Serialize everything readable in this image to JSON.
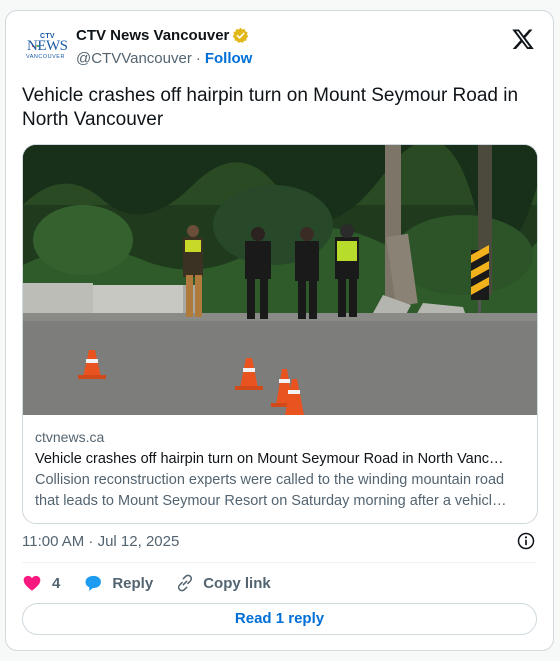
{
  "account": {
    "display_name": "CTV News Vancouver",
    "handle": "@CTVVancouver",
    "separator": "·",
    "follow_label": "Follow",
    "logo": {
      "brand_mark": "CTV",
      "wordmark": "NEWS",
      "city": "VANCOUVER",
      "brand_color": "#1a5aa6"
    },
    "verified_color": "#e2b719"
  },
  "tweet": {
    "text": "Vehicle crashes off hairpin turn on Mount Seymour Road in North Vancouver",
    "timestamp": "11:00 AM · Jul 12, 2025"
  },
  "link_card": {
    "domain": "ctvnews.ca",
    "title": "Vehicle crashes off hairpin turn on Mount Seymour Road in North Vanc…",
    "description": "Collision reconstruction experts were called to the winding mountain road that leads to Mount Seymour Resort on Saturday morning after a vehicl…",
    "image_description_icon": "photo-crash-scene"
  },
  "actions": {
    "like_count": "4",
    "reply_label": "Reply",
    "copy_label": "Copy link",
    "like_color": "#f91880",
    "reply_color": "#1d9bf0"
  },
  "read_reply_label": "Read 1 reply",
  "colors": {
    "link": "#006fd6",
    "secondary_text": "#536471",
    "border": "#cfd9de"
  }
}
